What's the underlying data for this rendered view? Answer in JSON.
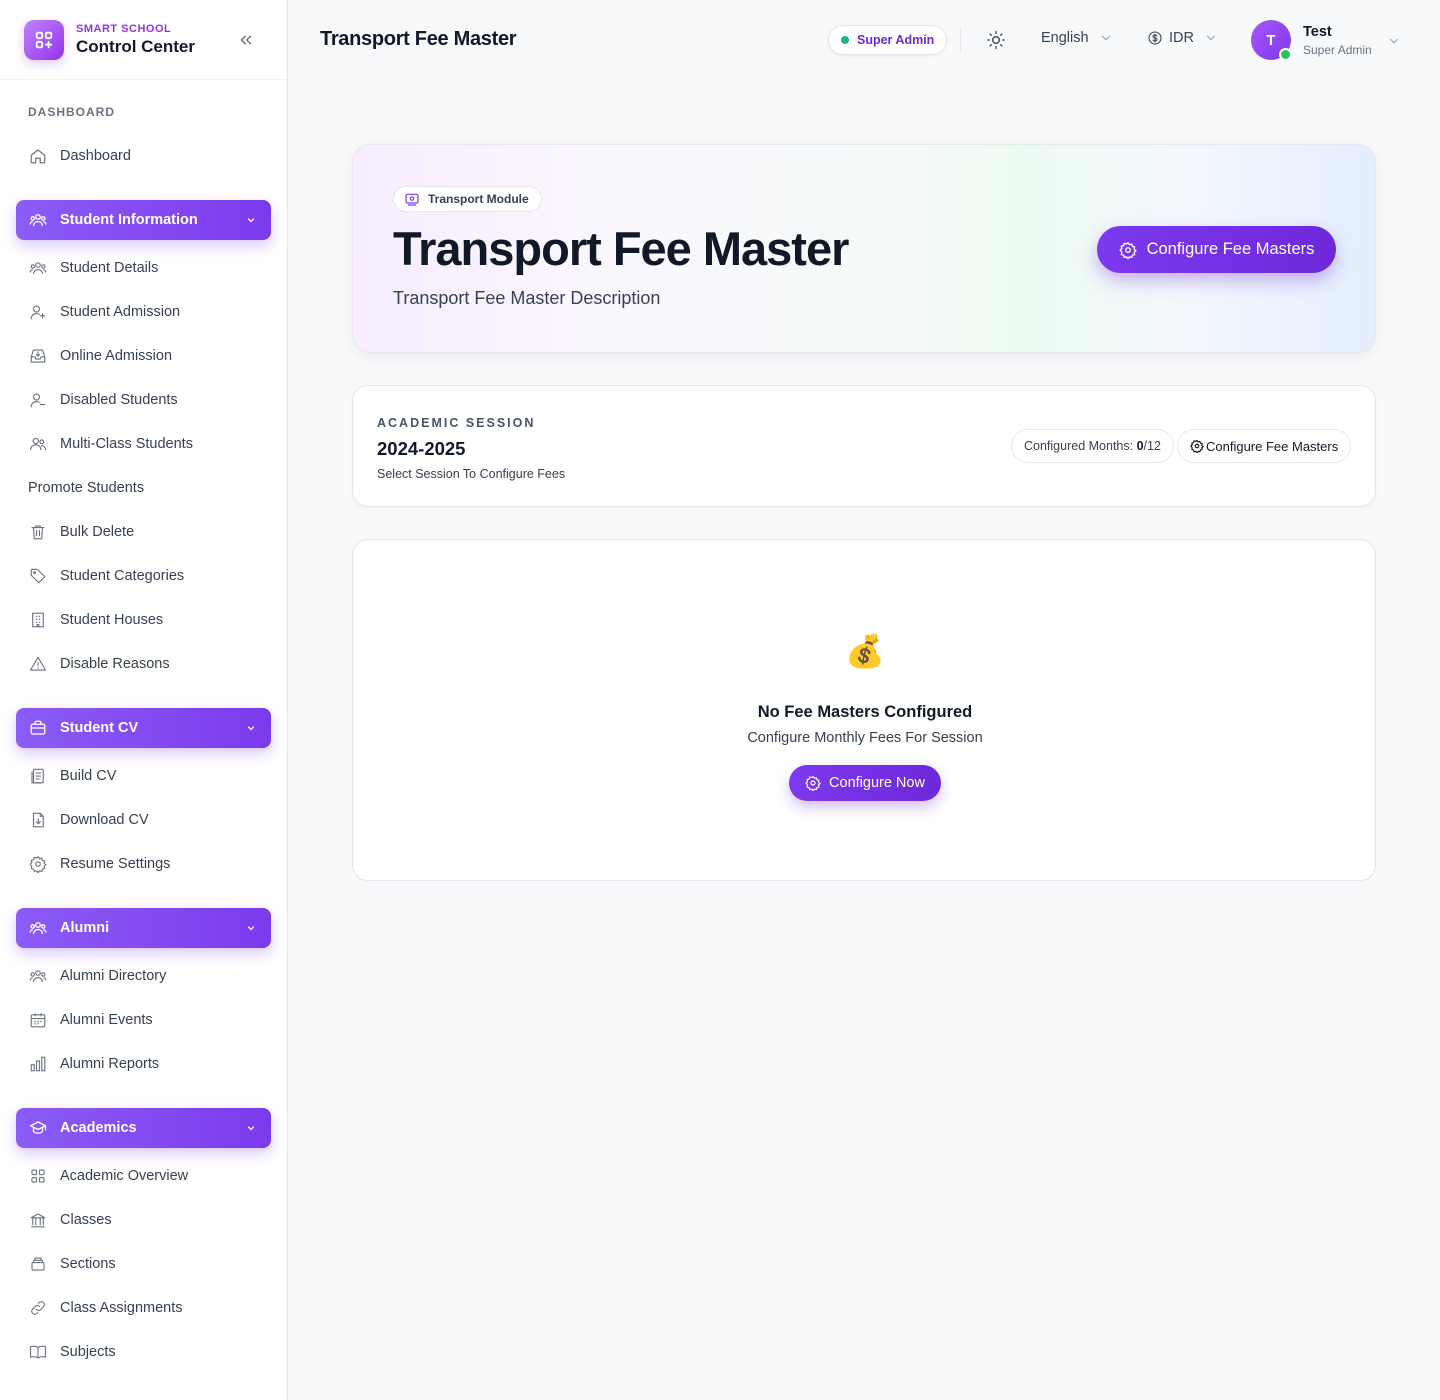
{
  "brand": {
    "small": "SMART SCHOOL",
    "title": "Control Center"
  },
  "sidebar": {
    "section_title": "DASHBOARD",
    "dashboard": "Dashboard",
    "groups": {
      "student_information": "Student Information",
      "student_cv": "Student CV",
      "alumni": "Alumni",
      "academics": "Academics"
    },
    "student_information_items": [
      {
        "label": "Student Details",
        "icon": "users-icon"
      },
      {
        "label": "Student Admission",
        "icon": "user-plus-icon"
      },
      {
        "label": "Online Admission",
        "icon": "inbox-icon"
      },
      {
        "label": "Disabled Students",
        "icon": "user-minus-icon"
      },
      {
        "label": "Multi-Class Students",
        "icon": "users-icon"
      },
      {
        "label": "Promote Students",
        "icon": ""
      },
      {
        "label": "Bulk Delete",
        "icon": "trash-icon"
      },
      {
        "label": "Student Categories",
        "icon": "tag-icon"
      },
      {
        "label": "Student Houses",
        "icon": "building-icon"
      },
      {
        "label": "Disable Reasons",
        "icon": "alert-triangle-icon"
      }
    ],
    "student_cv_items": [
      {
        "label": "Build CV",
        "icon": "file-icon"
      },
      {
        "label": "Download CV",
        "icon": "file-download-icon"
      },
      {
        "label": "Resume Settings",
        "icon": "gear-icon"
      }
    ],
    "alumni_items": [
      {
        "label": "Alumni Directory",
        "icon": "users-icon"
      },
      {
        "label": "Alumni Events",
        "icon": "calendar-icon"
      },
      {
        "label": "Alumni Reports",
        "icon": "bar-chart-icon"
      }
    ],
    "academics_items": [
      {
        "label": "Academic Overview",
        "icon": "grid-icon"
      },
      {
        "label": "Classes",
        "icon": "landmark-icon"
      },
      {
        "label": "Sections",
        "icon": "layers-icon"
      },
      {
        "label": "Class Assignments",
        "icon": "link-icon"
      },
      {
        "label": "Subjects",
        "icon": "book-icon"
      }
    ]
  },
  "header": {
    "title": "Transport Fee Master",
    "role": "Super Admin",
    "language": "English",
    "currency": "IDR",
    "user_initial": "T",
    "user_name": "Test",
    "user_role": "Super Admin"
  },
  "hero": {
    "badge": "Transport Module",
    "title": "Transport Fee Master",
    "description": "Transport Fee Master Description",
    "button": "Configure Fee Masters"
  },
  "session": {
    "label": "ACADEMIC SESSION",
    "value": "2024-2025",
    "hint": "Select Session To Configure Fees",
    "months_label": "Configured Months:",
    "months_configured": "0",
    "months_total": "/12",
    "button": "Configure Fee Masters"
  },
  "empty": {
    "emoji": "💰",
    "title": "No Fee Masters Configured",
    "description": "Configure Monthly Fees For Session",
    "button": "Configure Now"
  },
  "colors": {
    "accent": "#7c3aed",
    "online": "#22c55e",
    "status_dot": "#10b981"
  }
}
